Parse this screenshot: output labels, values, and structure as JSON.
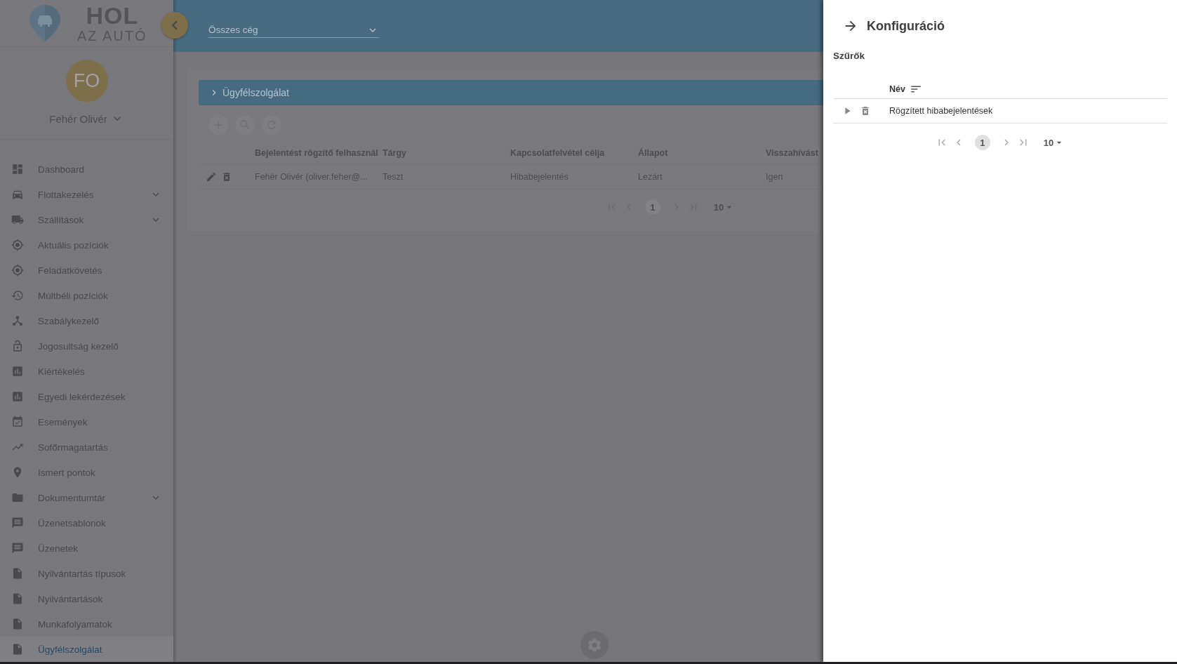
{
  "logo": {
    "line_1": "HOL",
    "line_2": "AZ AUTÓ"
  },
  "company_select": {
    "value": "Összes cég"
  },
  "user": {
    "initials": "FO",
    "name": "Fehér Olivér"
  },
  "nav": [
    {
      "label": "Dashboard",
      "submenu": false,
      "selected": false
    },
    {
      "label": "Flottakezelés",
      "submenu": true,
      "selected": false
    },
    {
      "label": "Szállítások",
      "submenu": true,
      "selected": false
    },
    {
      "label": "Aktuális pozíciók",
      "submenu": false,
      "selected": false
    },
    {
      "label": "Feladatkövetés",
      "submenu": false,
      "selected": false
    },
    {
      "label": "Múltbéli pozíciók",
      "submenu": false,
      "selected": false
    },
    {
      "label": "Szabálykezelő",
      "submenu": false,
      "selected": false
    },
    {
      "label": "Jogosultság kezelő",
      "submenu": false,
      "selected": false
    },
    {
      "label": "Kiértékelés",
      "submenu": false,
      "selected": false
    },
    {
      "label": "Egyedi lekérdezések",
      "submenu": false,
      "selected": false
    },
    {
      "label": "Események",
      "submenu": false,
      "selected": false
    },
    {
      "label": "Sofőrmagatartás",
      "submenu": false,
      "selected": false
    },
    {
      "label": "Ismert pontok",
      "submenu": false,
      "selected": false
    },
    {
      "label": "Dokumentumtár",
      "submenu": true,
      "selected": false
    },
    {
      "label": "Üzenetsablonok",
      "submenu": false,
      "selected": false
    },
    {
      "label": "Üzenetek",
      "submenu": false,
      "selected": false
    },
    {
      "label": "Nyilvántartás típusok",
      "submenu": false,
      "selected": false
    },
    {
      "label": "Nyilvántartások",
      "submenu": false,
      "selected": false
    },
    {
      "label": "Munkafolyamatok",
      "submenu": false,
      "selected": false
    },
    {
      "label": "Ügyfélszolgálat",
      "submenu": false,
      "selected": true
    }
  ],
  "breadcrumb": "Ügyfélszolgálat",
  "table": {
    "columns": [
      "Bejelentést rögzítő felhasznál",
      "Tárgy",
      "Kapcsolatfelvétel célja",
      "Állapot",
      "Visszahívást"
    ],
    "rows": [
      {
        "cells": [
          "Fehér Olivér (oliver.feher@...",
          "Teszt",
          "Hibabejelentés",
          "Lezárt",
          "Igen"
        ]
      }
    ]
  },
  "pagination": {
    "page": "1",
    "page_size": "10"
  },
  "drawer": {
    "title": "Konfiguráció",
    "section": "Szűrők",
    "columns": [
      "Név"
    ],
    "rows": [
      {
        "name": "Rögzített hibabejelentések",
        "expanded": false
      }
    ],
    "pagination": {
      "page": "1",
      "page_size": "10"
    }
  }
}
